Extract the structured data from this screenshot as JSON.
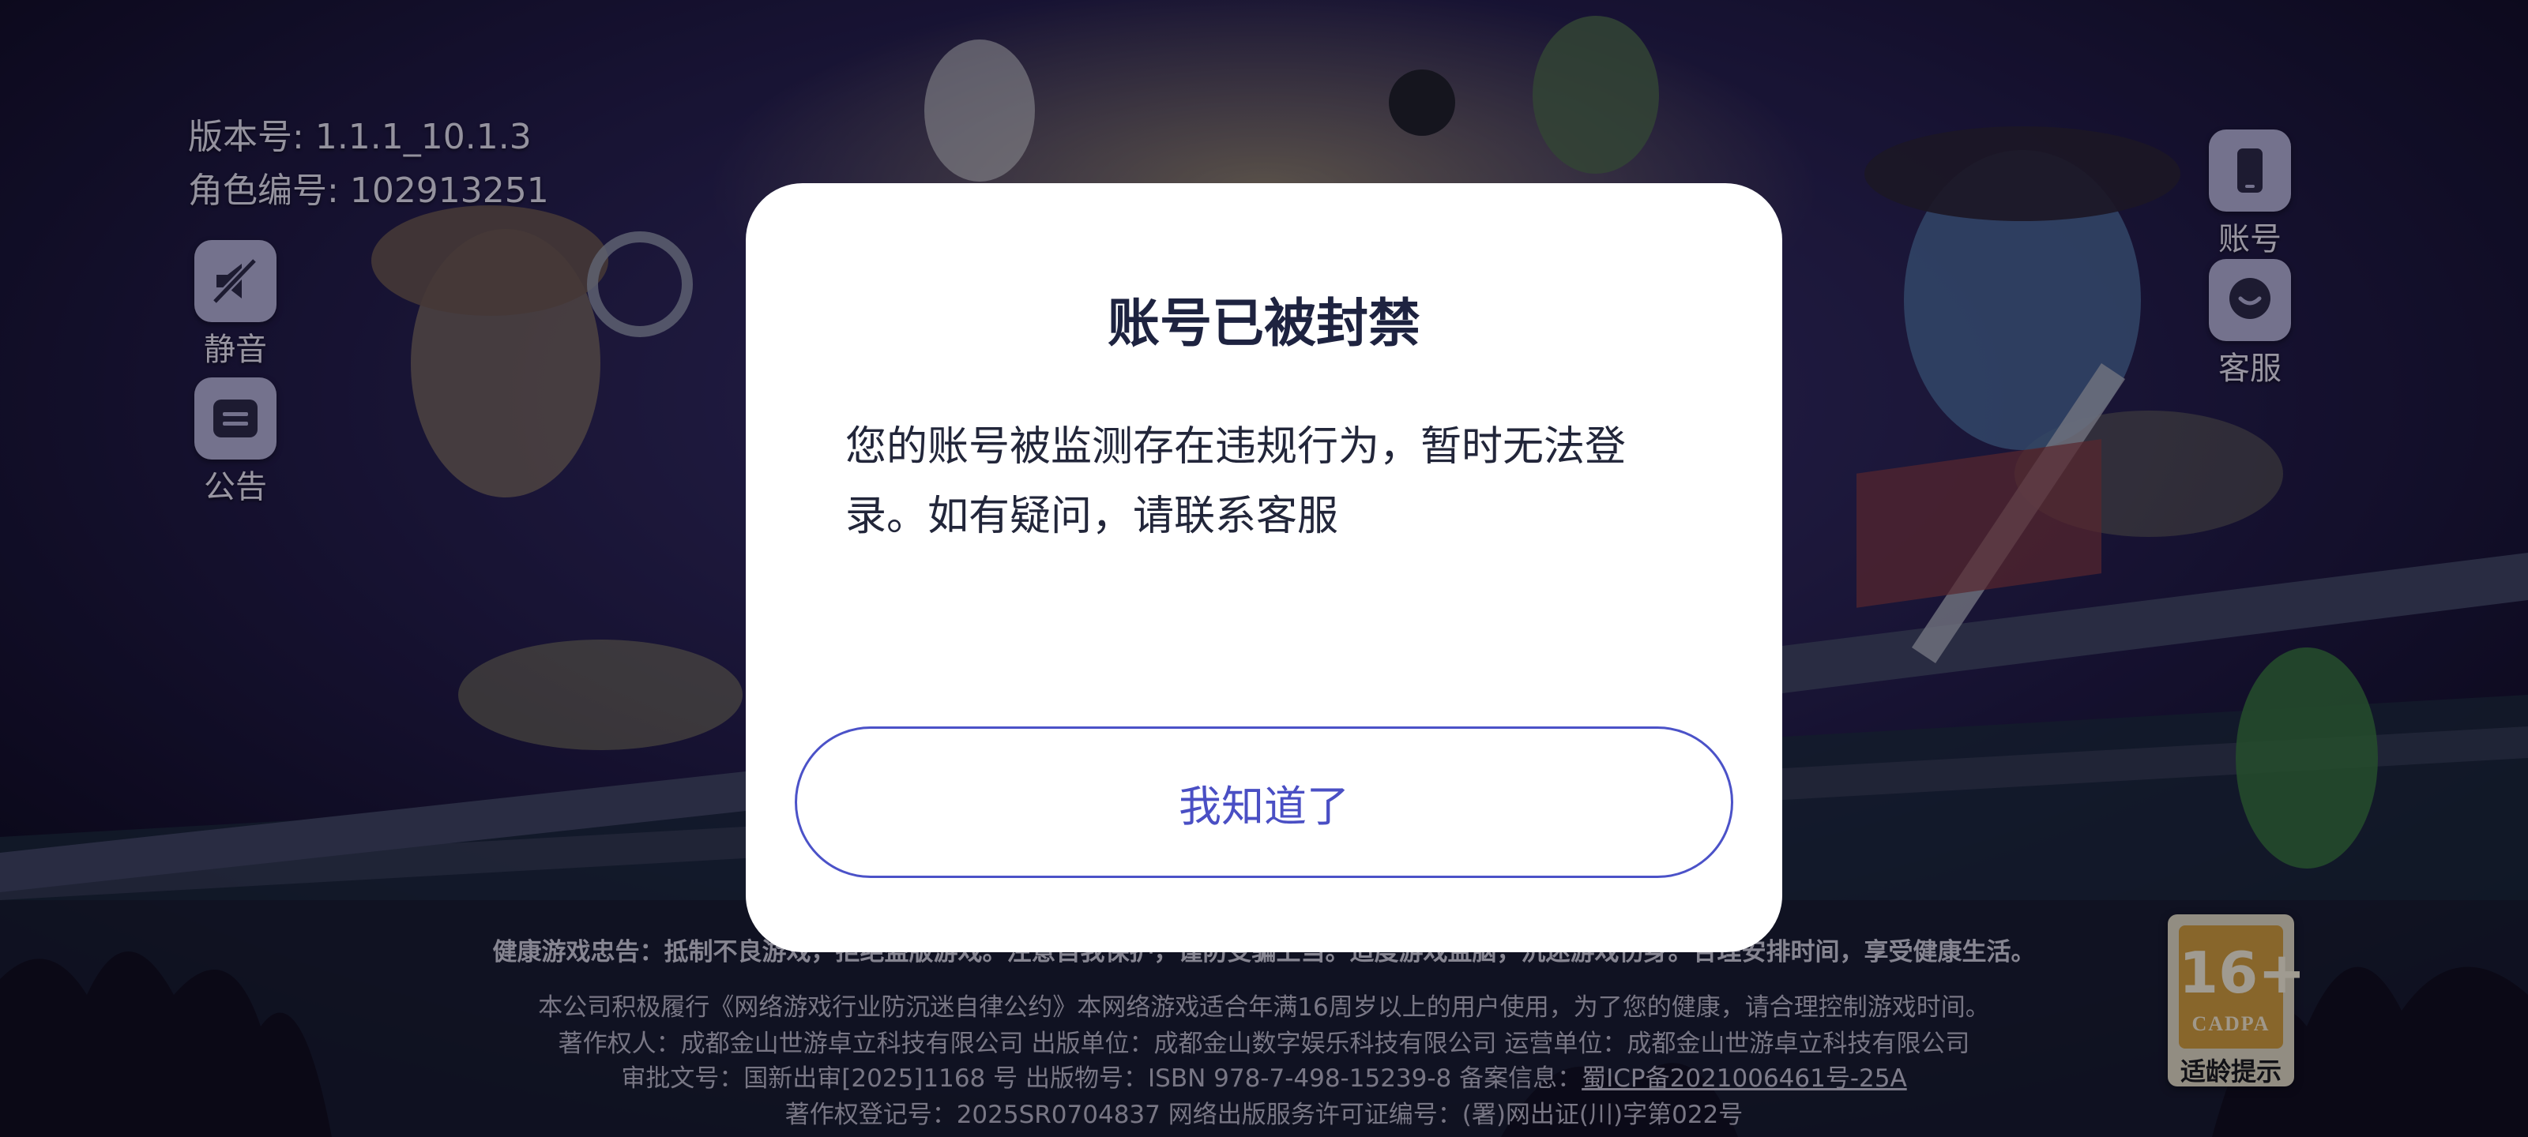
{
  "hud": {
    "version_label": "版本号:",
    "version": "1.1.1_10.1.3",
    "role_id_label": "角色编号:",
    "role_id": "102913251",
    "mute_label": "静音",
    "notice_label": "公告",
    "account_label": "账号",
    "support_label": "客服"
  },
  "dialog": {
    "title": "账号已被封禁",
    "body": "您的账号被监测存在违规行为，暂时无法登录。如有疑问，请联系客服",
    "confirm_label": "我知道了"
  },
  "footer": {
    "warning": "健康游戏忠告：抵制不良游戏，拒绝盗版游戏。注意自我保护，谨防受骗上当。适度游戏益脑，沉迷游戏伤身。合理安排时间，享受健康生活。",
    "line1": "本公司积极履行《网络游戏行业防沉迷自律公约》本网络游戏适合年满16周岁以上的用户使用，为了您的健康，请合理控制游戏时间。",
    "line2": "著作权人：成都金山世游卓立科技有限公司 出版单位：成都金山数字娱乐科技有限公司 运营单位：成都金山世游卓立科技有限公司",
    "line3_prefix": "审批文号：国新出审[2025]1168 号 出版物号：ISBN 978-7-498-15239-8 备案信息：",
    "line3_link": "蜀ICP备2021006461号-25A",
    "line4": "著作权登记号：2025SR0704837 网络出版服务许可证编号：(署)网出证(川)字第022号"
  },
  "age_rating": {
    "age": "16+",
    "org": "CADPA",
    "tip": "适龄提示"
  },
  "colors": {
    "accent": "#4b52c8",
    "dialog_bg": "#ffffff",
    "title": "#1e2340",
    "hud_tile": "#b9b5d9"
  },
  "icons": {
    "mute": "speaker-muted-icon",
    "notice": "notice-board-icon",
    "account": "phone-icon",
    "support": "chat-bubble-icon"
  }
}
